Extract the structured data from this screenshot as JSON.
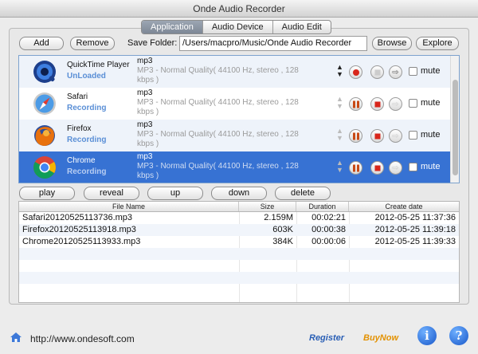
{
  "window": {
    "title": "Onde Audio Recorder"
  },
  "tabs": [
    {
      "label": "Application",
      "active": true
    },
    {
      "label": "Audio Device",
      "active": false
    },
    {
      "label": "Audio Edit",
      "active": false
    }
  ],
  "toolbar": {
    "add_label": "Add",
    "remove_label": "Remove",
    "save_folder_label": "Save Folder:",
    "save_folder_value": "/Users/macpro/Music/Onde Audio Recorder",
    "browse_label": "Browse",
    "explore_label": "Explore"
  },
  "apps": [
    {
      "name": "QuickTime Player",
      "status": "UnLoaded",
      "icon": "quicktime-icon",
      "format": "mp3",
      "quality_1": "MP3 - Normal Quality( 44100 Hz, stereo , 128",
      "quality_2": "kbps )",
      "state": "unloaded",
      "mute_label": "mute",
      "selected": false
    },
    {
      "name": "Safari",
      "status": "Recording",
      "icon": "safari-icon",
      "format": "mp3",
      "quality_1": "MP3 - Normal Quality( 44100 Hz, stereo , 128",
      "quality_2": "kbps )",
      "state": "recording",
      "mute_label": "mute",
      "selected": false
    },
    {
      "name": "Firefox",
      "status": "Recording",
      "icon": "firefox-icon",
      "format": "mp3",
      "quality_1": "MP3 - Normal Quality( 44100 Hz, stereo , 128",
      "quality_2": "kbps )",
      "state": "recording",
      "mute_label": "mute",
      "selected": false
    },
    {
      "name": "Chrome",
      "status": "Recording",
      "icon": "chrome-icon",
      "format": "mp3",
      "quality_1": "MP3 - Normal Quality( 44100 Hz, stereo , 128",
      "quality_2": "kbps )",
      "state": "recording",
      "mute_label": "mute",
      "selected": true
    }
  ],
  "file_actions": {
    "play_label": "play",
    "reveal_label": "reveal",
    "up_label": "up",
    "down_label": "down",
    "delete_label": "delete"
  },
  "files": {
    "columns": [
      "File Name",
      "Size",
      "Duration",
      "Create date"
    ],
    "rows": [
      [
        "Safari20120525113736.mp3",
        "2.159M",
        "00:02:21",
        "2012-05-25 11:37:36"
      ],
      [
        "Firefox20120525113918.mp3",
        "603K",
        "00:00:38",
        "2012-05-25 11:39:18"
      ],
      [
        "Chrome20120525113933.mp3",
        "384K",
        "00:00:06",
        "2012-05-25 11:39:33"
      ]
    ]
  },
  "footer": {
    "url": "http://www.ondesoft.com",
    "register_label": "Register",
    "buynow_label": "BuyNow",
    "info_label": "i",
    "help_label": "?"
  },
  "colors": {
    "selection": "#3772d3",
    "recording_text": "#5a8fd6",
    "record_button": "#d8261b"
  }
}
